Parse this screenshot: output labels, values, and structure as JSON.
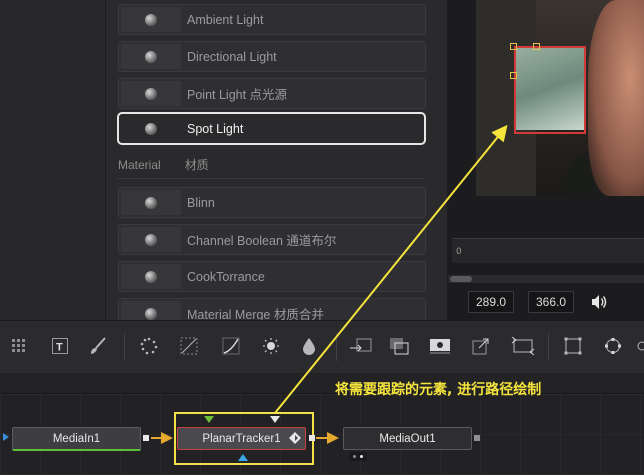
{
  "library": {
    "lights": [
      {
        "label": "Ambient Light"
      },
      {
        "label": "Directional Light"
      },
      {
        "label": "Point Light 点光源"
      },
      {
        "label": "Spot Light",
        "selected": true
      }
    ],
    "material_section": {
      "title": "Material",
      "subtitle": "材质"
    },
    "materials": [
      {
        "label": "Blinn"
      },
      {
        "label": "Channel Boolean 通道布尔"
      },
      {
        "label": "CookTorrance"
      },
      {
        "label": "Material Merge 材质合并"
      }
    ]
  },
  "viewer": {
    "timeline_start": "0",
    "coord_x": "289.0",
    "coord_y": "366.0",
    "volume_icon": "speaker-icon"
  },
  "toolbar": {
    "tools": [
      "grid-icon",
      "text-icon",
      "paint-icon",
      "particles-icon",
      "mask-icon",
      "curves-icon",
      "brightness-icon",
      "drop-icon",
      "transform-icon",
      "merge-icon",
      "background-icon",
      "resize-icon",
      "tracker-icon",
      "crop-icon",
      "loop-icon"
    ]
  },
  "nodes": {
    "media_in": "MediaIn1",
    "tracker": "PlanarTracker1",
    "media_out": "MediaOut1"
  },
  "annotation": {
    "text": "将需要跟踪的元素, 进行路径绘制",
    "color": "#f4e43c"
  }
}
